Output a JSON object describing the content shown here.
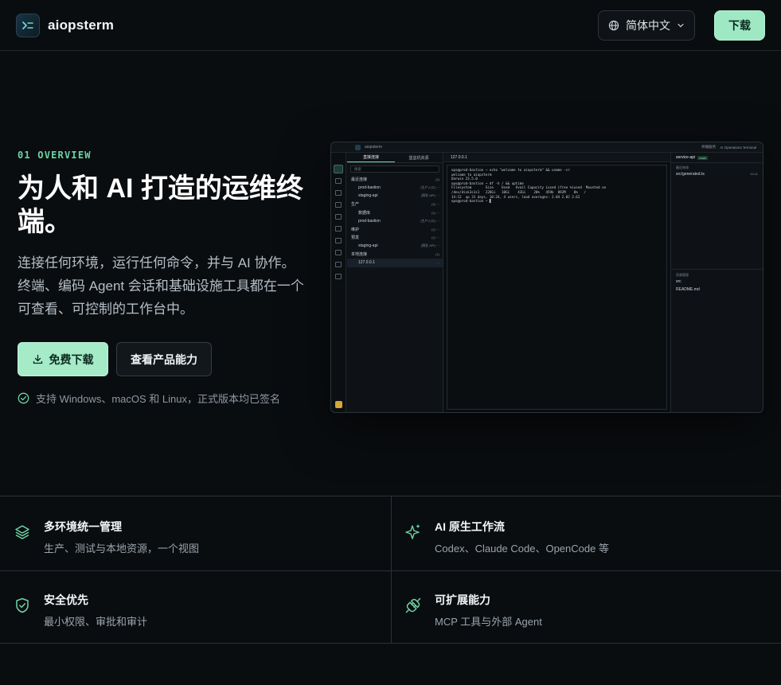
{
  "header": {
    "brand": "aiopsterm",
    "language": "简体中文",
    "download_label": "下载"
  },
  "hero": {
    "eyebrow": "01 OVERVIEW",
    "title": "为人和 AI 打造的运维终端。",
    "description": "连接任何环境，运行任何命令，并与 AI 协作。终端、编码 Agent 会话和基础设施工具都在一个可查看、可控制的工作台中。",
    "primary_button": "免费下载",
    "secondary_button": "查看产品能力",
    "support_note": "支持 Windows、macOS 和 Linux，正式版本均已签名"
  },
  "mockup": {
    "app_name": "aiopsterm",
    "top_right": [
      "终端服务",
      "AI Operations Terminal"
    ],
    "sidebar_tabs": [
      "直接连接",
      "堡垒机资源"
    ],
    "search_placeholder": "搜索",
    "tree": [
      {
        "label": "最近连接",
        "badge": "(2)",
        "level": 0
      },
      {
        "label": "prod-bastion",
        "badge": "(生产入口) ···",
        "level": 1
      },
      {
        "label": "staging-api",
        "badge": "(预发 API) ···",
        "level": 1
      },
      {
        "label": "生产",
        "badge": "(3) ···",
        "level": 0
      },
      {
        "label": "数据库",
        "badge": "(1) ···",
        "level": 1
      },
      {
        "label": "prod-bastion",
        "badge": "(生产入口) ···",
        "level": 1
      },
      {
        "label": "维护",
        "badge": "(1) ···",
        "level": 0
      },
      {
        "label": "预发",
        "badge": "(1) ···",
        "level": 0
      },
      {
        "label": "staging-api",
        "badge": "(预发 API) ···",
        "level": 1
      },
      {
        "label": "本地连接",
        "badge": "(1)",
        "level": 0
      },
      {
        "label": "127.0.0.1",
        "badge": "···",
        "level": 1
      }
    ],
    "terminal_tab": "127.0.0.1",
    "terminal_lines": [
      "ops@prod-bastion ~ echo \"welcome to aiopsterm\" && uname -sr",
      "welcome to aiopsterm",
      "Darwin 23.5.0",
      "ops@prod-bastion ~ df -h / && uptime",
      "Filesystem       Size    Used   Avail Capacity iused ifree %iused  Mounted on",
      "/dev/disk3s1s1   228Gi   10Gi    43Gi    20%   459k  892M    0%   /",
      "14:12  up 31 days, 10:24, 4 users, load averages: 2.04 2.02 2.62",
      "ops@prod-bastion ~ ▋"
    ],
    "right_panel": {
      "title": "service-api",
      "badge": "main",
      "recent_label": "最近修改",
      "recent_file": "src/generated.ts",
      "recent_time": "14:11",
      "files_label": "资源管理",
      "files": [
        "src",
        "README.md"
      ]
    }
  },
  "features": [
    {
      "icon": "layers-icon",
      "title": "多环境统一管理",
      "subtitle": "生产、测试与本地资源，一个视图"
    },
    {
      "icon": "sparkle-icon",
      "title": "AI 原生工作流",
      "subtitle": "Codex、Claude Code、OpenCode 等"
    },
    {
      "icon": "shield-icon",
      "title": "安全优先",
      "subtitle": "最小权限、审批和审计"
    },
    {
      "icon": "plug-icon",
      "title": "可扩展能力",
      "subtitle": "MCP 工具与外部 Agent"
    }
  ],
  "colors": {
    "accent": "#9fe8c4",
    "eyebrow": "#6fd3a5",
    "background": "#0a0d10"
  }
}
